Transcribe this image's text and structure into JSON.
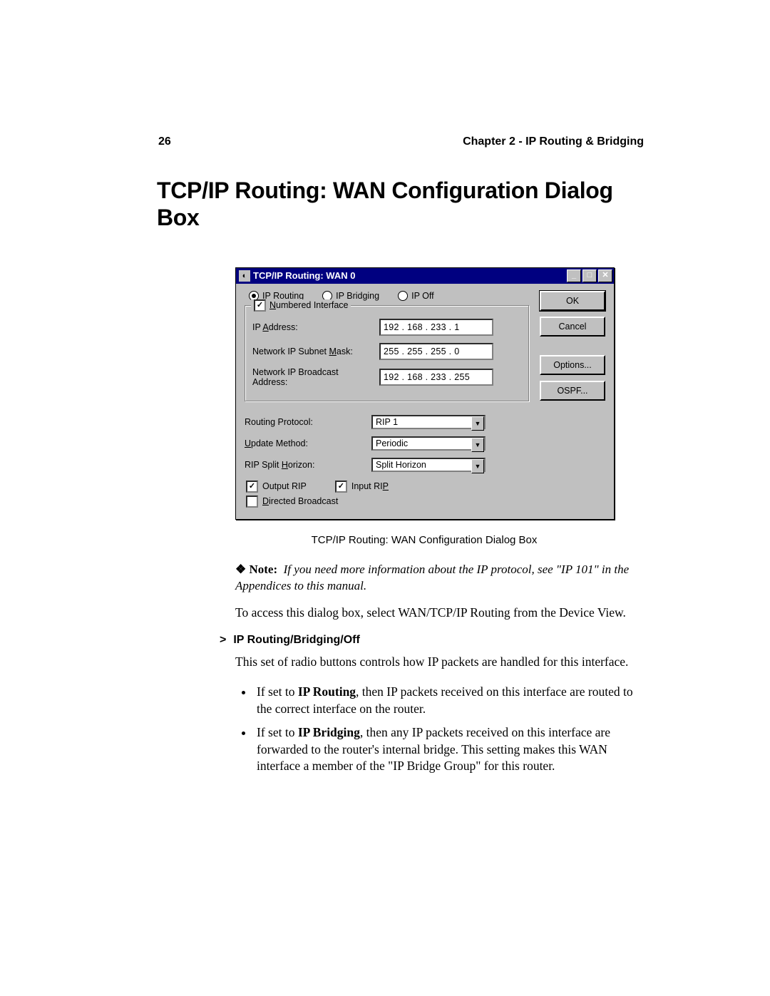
{
  "header": {
    "page_num": "26",
    "chapter": "Chapter 2 - IP Routing & Bridging"
  },
  "title": "TCP/IP Routing: WAN Configuration Dialog Box",
  "dialog": {
    "titlebar": "TCP/IP Routing: WAN 0",
    "radios": {
      "routing": "IP Routing",
      "bridging": "IP Bridging",
      "off": "IP Off"
    },
    "group_legend": "Numbered Interface",
    "labels": {
      "ip_addr": "IP Address:",
      "subnet": "Network IP Subnet Mask:",
      "broadcast": "Network IP Broadcast Address:",
      "proto": "Routing Protocol:",
      "update": "Update Method:",
      "split": "RIP Split Horizon:"
    },
    "values": {
      "ip_addr": "192 . 168 . 233 .   1",
      "subnet": "255 . 255 . 255 .   0",
      "broadcast": "192 . 168 . 233 . 255",
      "proto": "RIP 1",
      "update": "Periodic",
      "split": "Split Horizon"
    },
    "checks": {
      "output_rip": "Output RIP",
      "input_rip": "Input RIP",
      "directed": "Directed Broadcast"
    },
    "buttons": {
      "ok": "OK",
      "cancel": "Cancel",
      "options": "Options...",
      "ospf": "OSPF..."
    }
  },
  "caption": "TCP/IP Routing: WAN Configuration Dialog Box",
  "note_prefix": "❖ Note:",
  "note_body": "If you need more information about the IP protocol, see \"IP 101\" in the Appendices to this manual.",
  "access_text": "To access this dialog box, select WAN/TCP/IP Routing from the Device View.",
  "section_head": "IP Routing/Bridging/Off",
  "section_intro": "This set of radio buttons controls how IP packets are handled for this interface.",
  "bullets": {
    "b1a": "If set to ",
    "b1bold": "IP Routing",
    "b1b": ", then IP packets received on this interface are routed to the correct interface on the router.",
    "b2a": "If set to ",
    "b2bold": "IP Bridging",
    "b2b": ", then any IP packets received on this interface are forwarded to the router's internal bridge. This setting makes this WAN interface a member of the \"IP Bridge Group\" for this router."
  }
}
